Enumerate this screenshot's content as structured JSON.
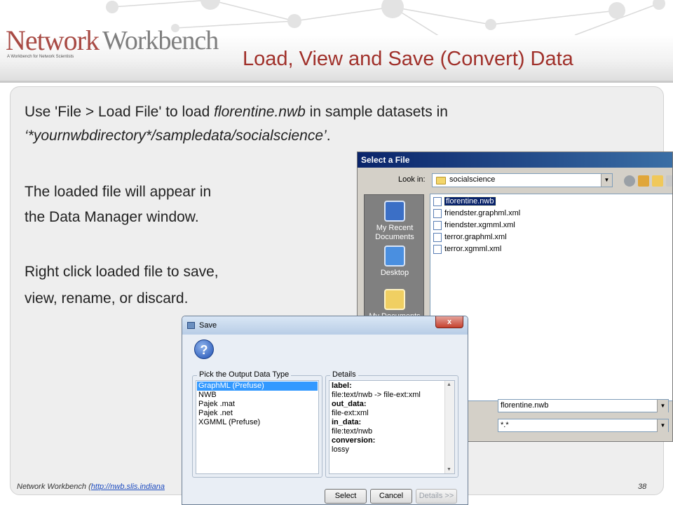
{
  "slide": {
    "logo_network": "Network",
    "logo_workbench": "Workbench",
    "logo_tagline": "A Workbench for Network Scientists",
    "title": "Load, View and Save (Convert) Data",
    "line1_a": "Use 'File > Load File' to load ",
    "line1_b": "florentine.nwb",
    "line1_c": " in sample datasets in",
    "line2_a": "‘*yournwbdirectory*/sampledata/socialscience’",
    "line2_b": ".",
    "line3": "The loaded file will appear in",
    "line4": "the Data Manager window.",
    "line5": "Right click loaded file to save,",
    "line6": "view, rename, or discard.",
    "footer_prefix": "Network Workbench (",
    "footer_link": "http://nwb.slis.indiana",
    "page_number": "38"
  },
  "file_dialog": {
    "title": "Select a File",
    "look_in_label": "Look in:",
    "look_in_value": "socialscience",
    "places": [
      {
        "label": "My Recent Documents",
        "icon": "recent-documents-icon"
      },
      {
        "label": "Desktop",
        "icon": "desktop-icon"
      },
      {
        "label": "My Documents",
        "icon": "my-documents-icon"
      }
    ],
    "files": [
      "florentine.nwb",
      "friendster.graphml.xml",
      "friendster.xgmml.xml",
      "terror.graphml.xml",
      "terror.xgmml.xml"
    ],
    "selected_file": "florentine.nwb",
    "file_name_value": "florentine.nwb",
    "file_type_value": "*.*"
  },
  "save_dialog": {
    "title": "Save",
    "close_glyph": "x",
    "output_group_label": "Pick the Output Data Type",
    "output_types": [
      "GraphML (Prefuse)",
      "NWB",
      "Pajek .mat",
      "Pajek .net",
      "XGMML (Prefuse)"
    ],
    "selected_type": "GraphML (Prefuse)",
    "details_group_label": "Details",
    "details": [
      {
        "text": "label:",
        "bold": true
      },
      {
        "text": "file:text/nwb -> file-ext:xml",
        "bold": false
      },
      {
        "text": "out_data:",
        "bold": true
      },
      {
        "text": "file-ext:xml",
        "bold": false
      },
      {
        "text": "in_data:",
        "bold": true
      },
      {
        "text": "file:text/nwb",
        "bold": false
      },
      {
        "text": "conversion:",
        "bold": true
      },
      {
        "text": "lossy",
        "bold": false
      }
    ],
    "select_label": "Select",
    "cancel_label": "Cancel",
    "details_label": "Details >>"
  },
  "colors": {
    "title_red": "#a0302a",
    "xp_title_blue": "#0a246a",
    "selection_blue": "#3399ff"
  }
}
